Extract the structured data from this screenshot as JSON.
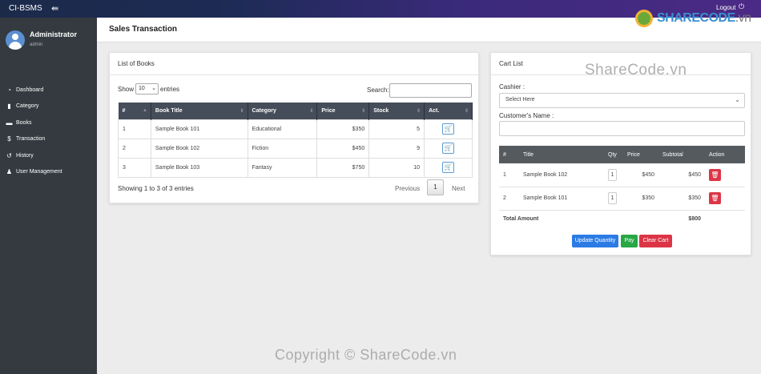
{
  "topbar": {
    "brand": "CI-BSMS",
    "menu_icon": "hamburger-icon",
    "logout_label": "Logout",
    "logout_icon": "power-icon"
  },
  "sidebar": {
    "user_name": "Administrator",
    "user_role": "admin",
    "items": [
      {
        "label": "Dashboard",
        "icon": "dashboard-icon",
        "glyph": "◔"
      },
      {
        "label": "Category",
        "icon": "bookmark-icon",
        "glyph": "▮"
      },
      {
        "label": "Books",
        "icon": "book-icon",
        "glyph": "▬"
      },
      {
        "label": "Transaction",
        "icon": "dollar-icon",
        "glyph": "$"
      },
      {
        "label": "History",
        "icon": "history-icon",
        "glyph": "↺"
      },
      {
        "label": "User Management",
        "icon": "users-icon",
        "glyph": "♟"
      }
    ]
  },
  "page": {
    "title": "Sales Transaction"
  },
  "books_card": {
    "title": "List of Books",
    "show_label": "Show",
    "page_length": "10",
    "entries_label": "entries",
    "search_label": "Search:",
    "search_value": "",
    "columns": [
      "#",
      "Book Title",
      "Category",
      "Price",
      "Stock",
      "Act."
    ],
    "rows": [
      {
        "num": "1",
        "title": "Sample Book 101",
        "category": "Educational",
        "price": "$350",
        "stock": "5"
      },
      {
        "num": "2",
        "title": "Sample Book 102",
        "category": "Fiction",
        "price": "$450",
        "stock": "9"
      },
      {
        "num": "3",
        "title": "Sample Book 103",
        "category": "Fantasy",
        "price": "$750",
        "stock": "10"
      }
    ],
    "info": "Showing 1 to 3 of 3 entries",
    "prev_label": "Previous",
    "current_page": "1",
    "next_label": "Next"
  },
  "cart_card": {
    "title": "Cart List",
    "cashier_label": "Cashier :",
    "cashier_selected": "Select Here",
    "customer_label": "Customer's Name :",
    "customer_value": "",
    "columns": [
      "#",
      "Title",
      "Qty",
      "Price",
      "Subtotal",
      "Action"
    ],
    "rows": [
      {
        "num": "1",
        "title": "Sample Book 102",
        "qty": "1",
        "price": "$450",
        "subtotal": "$450"
      },
      {
        "num": "2",
        "title": "Sample Book 101",
        "qty": "1",
        "price": "$350",
        "subtotal": "$350"
      }
    ],
    "total_label": "Total Amount",
    "total_value": "$800",
    "update_label": "Update Quantity",
    "pay_label": "Pay",
    "clear_label": "Clear Cart"
  },
  "watermarks": {
    "logo_main": "SHARECODE",
    "logo_suffix": ".vn",
    "center_text": "ShareCode.vn",
    "footer_text": "Copyright © ShareCode.vn"
  },
  "colors": {
    "sidebar_bg": "#343a40",
    "table_header": "#454c5a",
    "primary": "#2c7be5",
    "success": "#28a745",
    "danger": "#dc3545"
  }
}
